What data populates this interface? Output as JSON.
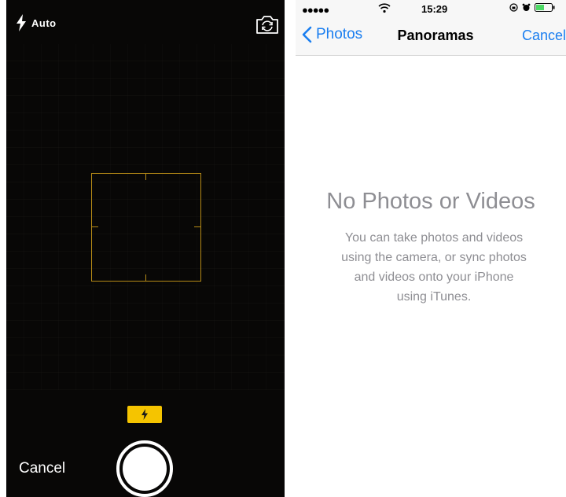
{
  "camera": {
    "flash_mode": "Auto",
    "cancel_label": "Cancel",
    "accent_color": "#f5c400"
  },
  "status_bar": {
    "signal": "●●●●●",
    "time": "15:29"
  },
  "nav": {
    "back_label": "Photos",
    "title": "Panoramas",
    "cancel_label": "Cancel",
    "tint_color": "#1a7ef0"
  },
  "empty_state": {
    "title": "No Photos or Videos",
    "body_line1": "You can take photos and videos",
    "body_line2": "using the camera, or sync photos",
    "body_line3": "and videos onto your iPhone",
    "body_line4": "using iTunes."
  }
}
